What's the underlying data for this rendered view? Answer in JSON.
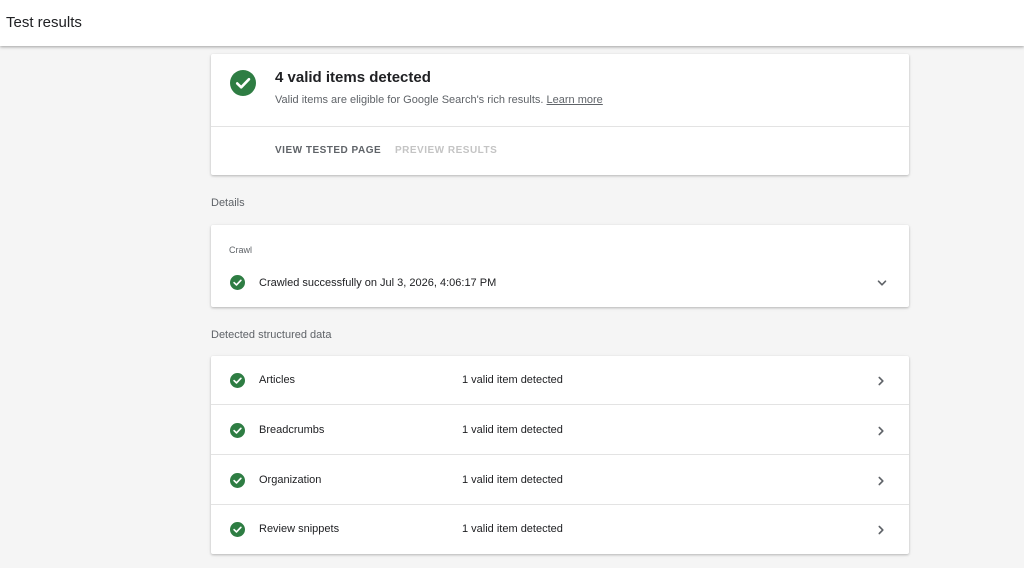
{
  "header": {
    "title": "Test results"
  },
  "summary": {
    "heading": "4 valid items detected",
    "description": "Valid items are eligible for Google Search's rich results.",
    "learn_more": "Learn more",
    "view_tested_page": "VIEW TESTED PAGE",
    "preview_results": "PREVIEW RESULTS"
  },
  "details": {
    "section_label": "Details",
    "crawl_label": "Crawl",
    "crawl_status": "Crawled successfully on Jul 3, 2026, 4:06:17 PM"
  },
  "structured_data": {
    "section_label": "Detected structured data",
    "items": [
      {
        "name": "Articles",
        "status": "1 valid item detected"
      },
      {
        "name": "Breadcrumbs",
        "status": "1 valid item detected"
      },
      {
        "name": "Organization",
        "status": "1 valid item detected"
      },
      {
        "name": "Review snippets",
        "status": "1 valid item detected"
      }
    ]
  },
  "colors": {
    "valid": "#2e7d43",
    "text": "#202124",
    "muted": "#5f6368"
  },
  "icons": {
    "valid": "check-circle-icon",
    "expand": "chevron-down-icon",
    "open": "chevron-right-icon"
  }
}
